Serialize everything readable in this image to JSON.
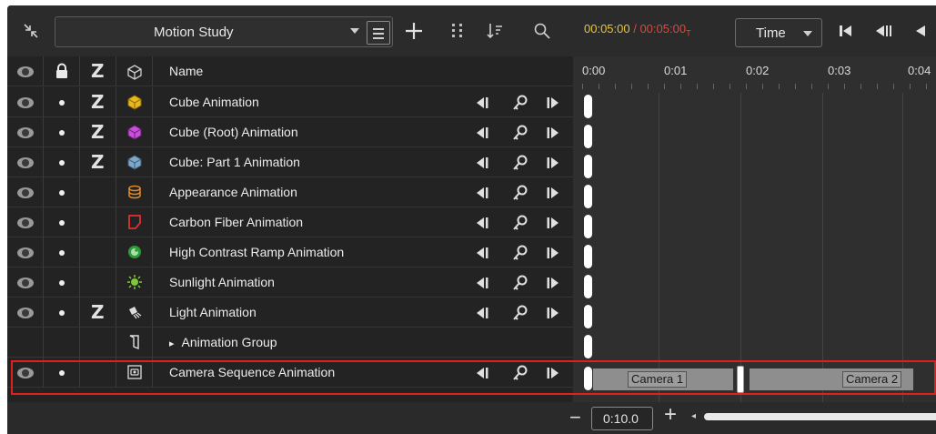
{
  "toolbar": {
    "study_name": "Motion Study",
    "time_current": "00:05:00",
    "time_separator": " / ",
    "time_total": "00:05:00",
    "time_total_suffix": "T",
    "time_mode": "Time"
  },
  "table": {
    "header": {
      "name": "Name"
    },
    "rows": [
      {
        "name": "Cube Animation",
        "eye": true,
        "lock": true,
        "z": true,
        "icon": "cube-yellow-icon"
      },
      {
        "name": "Cube (Root) Animation",
        "eye": true,
        "lock": true,
        "z": true,
        "icon": "cube-magenta-icon"
      },
      {
        "name": "Cube: Part 1 Animation",
        "eye": true,
        "lock": true,
        "z": true,
        "icon": "cube-blue-icon"
      },
      {
        "name": "Appearance Animation",
        "eye": true,
        "lock": true,
        "z": false,
        "icon": "appearance-icon"
      },
      {
        "name": "Carbon Fiber Animation",
        "eye": true,
        "lock": true,
        "z": false,
        "icon": "carbon-fiber-icon"
      },
      {
        "name": "High Contrast Ramp Animation",
        "eye": true,
        "lock": true,
        "z": false,
        "icon": "environment-icon"
      },
      {
        "name": "Sunlight Animation",
        "eye": true,
        "lock": true,
        "z": false,
        "icon": "sunlight-icon"
      },
      {
        "name": "Light Animation",
        "eye": true,
        "lock": true,
        "z": true,
        "icon": "light-icon"
      },
      {
        "name": "Animation Group",
        "eye": false,
        "lock": false,
        "z": false,
        "icon": "group-icon",
        "expander": "▸"
      },
      {
        "name": "Camera Sequence Animation",
        "eye": true,
        "lock": true,
        "z": false,
        "icon": "camera-sequence-icon"
      }
    ]
  },
  "timeline": {
    "ticks": [
      "0:00",
      "0:01",
      "0:02",
      "0:03",
      "0:04"
    ],
    "camera_1": "Camera 1",
    "camera_2": "Camera 2"
  },
  "bottom": {
    "zoom_out": "−",
    "zoom_value": "0:10.0",
    "zoom_in": "+"
  },
  "colors": {
    "time_current": "#e8c63a",
    "time_total": "#d94a3a",
    "selection_outline": "#e02020"
  }
}
